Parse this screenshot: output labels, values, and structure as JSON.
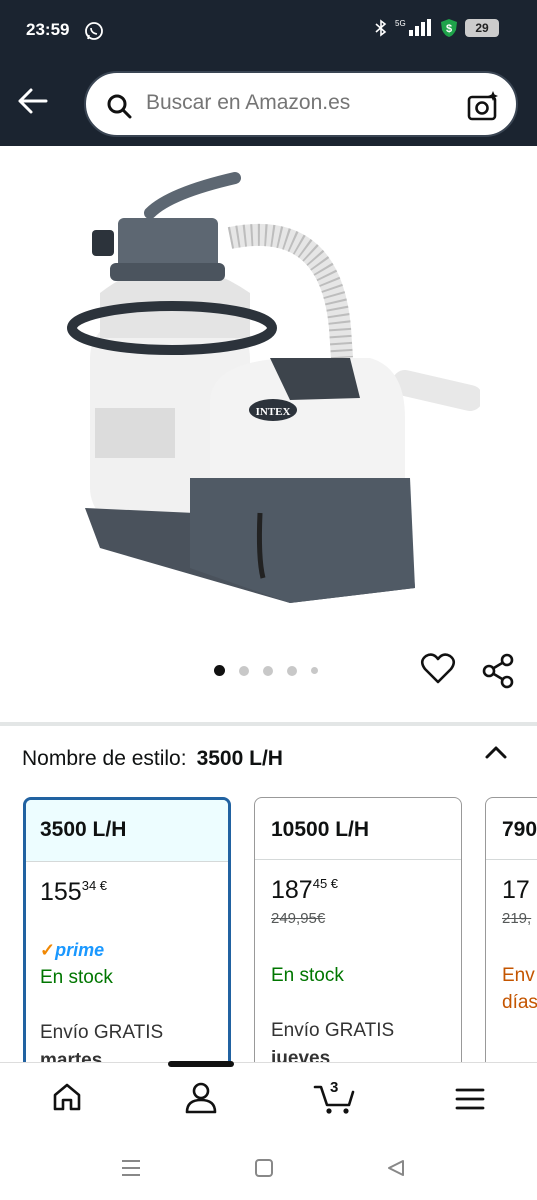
{
  "status_bar": {
    "time": "23:59",
    "network": "5G",
    "battery": "29",
    "icons": [
      "whatsapp-icon",
      "bluetooth-icon",
      "signal-icon",
      "shield-icon",
      "battery-icon"
    ]
  },
  "search": {
    "placeholder": "Buscar en Amazon.es",
    "icons": [
      "back-icon",
      "search-icon",
      "camera-icon"
    ]
  },
  "product": {
    "image_label": "INTEX",
    "image_count": 5,
    "active_image": 1
  },
  "style_selector": {
    "label": "Nombre de estilo:",
    "selected": "3500 L/H",
    "options": [
      {
        "name": "3500 L/H",
        "price_whole": "155",
        "price_fraction": "34 €",
        "old_price": "",
        "prime": "prime",
        "stock": "En stock",
        "shipping": "Envío GRATIS",
        "shipping_day": "martes"
      },
      {
        "name": "10500 L/H",
        "price_whole": "187",
        "price_fraction": "45 €",
        "old_price": "249,95€",
        "prime": "",
        "stock": "En stock",
        "shipping": "Envío GRATIS",
        "shipping_day": "jueves"
      },
      {
        "name": "790",
        "price_whole": "17",
        "price_fraction": "",
        "old_price": "219,",
        "prime": "",
        "stock": "Env",
        "stock2": "días",
        "shipping": "",
        "shipping_day": ""
      }
    ]
  },
  "bottom_nav": {
    "items": [
      "home-icon",
      "account-icon",
      "cart-icon",
      "menu-icon"
    ],
    "cart_count": "3",
    "active": "account-icon"
  },
  "colors": {
    "header": "#1b2430",
    "selected_border": "#2162a1",
    "stock_green": "#007600",
    "prime_blue": "#1a98ff",
    "delivery_orange": "#c45500"
  }
}
